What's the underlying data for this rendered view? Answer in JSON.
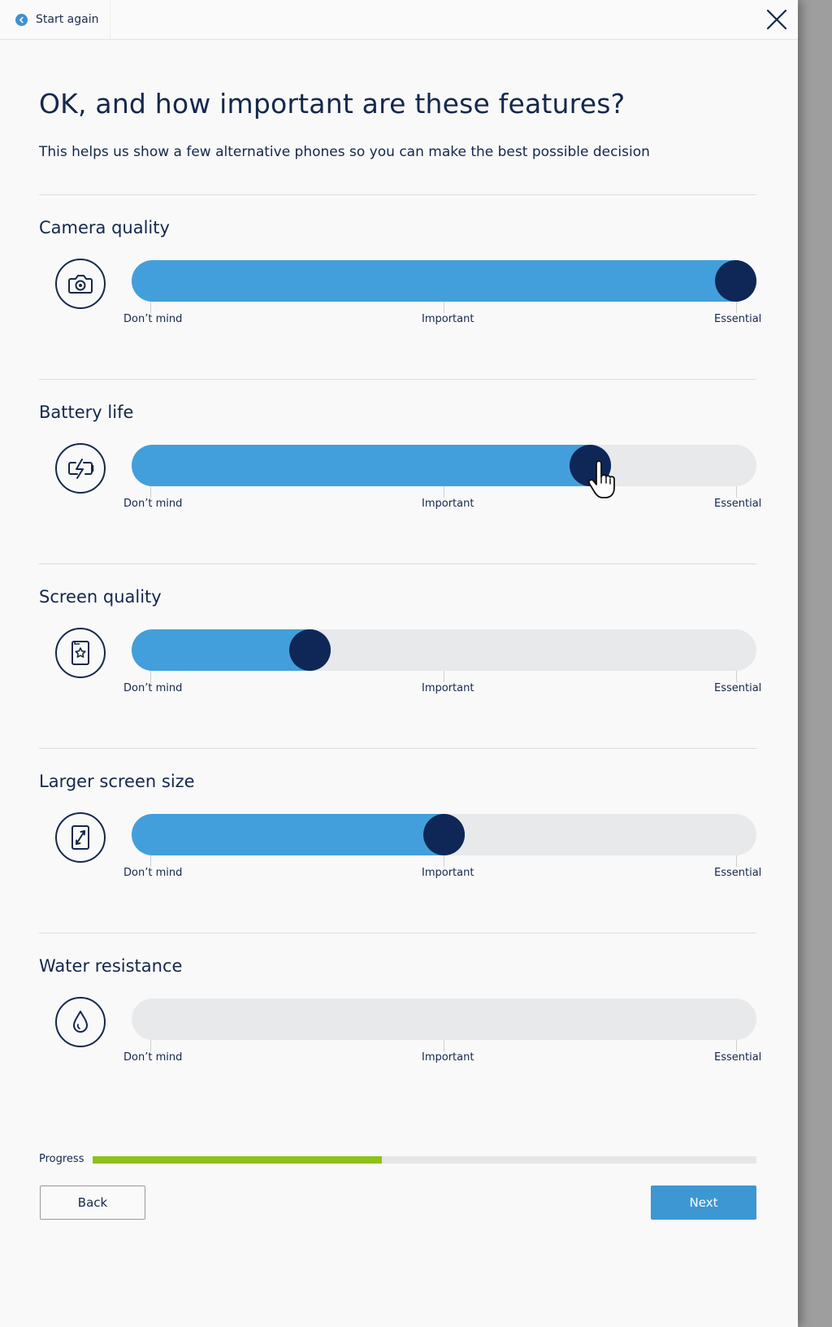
{
  "header": {
    "start_again_label": "Start again"
  },
  "page": {
    "title": "OK, and how important are these features?",
    "subtitle": "This helps us show a few alternative phones so you can make the best possible decision"
  },
  "scale_labels": {
    "low": "Don’t mind",
    "mid": "Important",
    "high": "Essential"
  },
  "features": [
    {
      "name": "Camera quality",
      "icon": "camera-icon",
      "level": 1.0
    },
    {
      "name": "Battery life",
      "icon": "battery-charging-icon",
      "level": 0.75
    },
    {
      "name": "Screen quality",
      "icon": "screen-star-icon",
      "level": 0.27
    },
    {
      "name": "Larger screen size",
      "icon": "screen-resize-icon",
      "level": 0.5
    },
    {
      "name": "Water resistance",
      "icon": "water-drop-icon",
      "level": null
    }
  ],
  "progress": {
    "label": "Progress",
    "fraction": 0.436
  },
  "actions": {
    "back_label": "Back",
    "next_label": "Next"
  },
  "colors": {
    "navy": "#14284b",
    "slider_fill": "#439fdb",
    "slider_thumb": "#0f2756",
    "slider_track": "#e8e9eb",
    "progress_fill": "#8cc21a",
    "next_button": "#3c97d3"
  }
}
